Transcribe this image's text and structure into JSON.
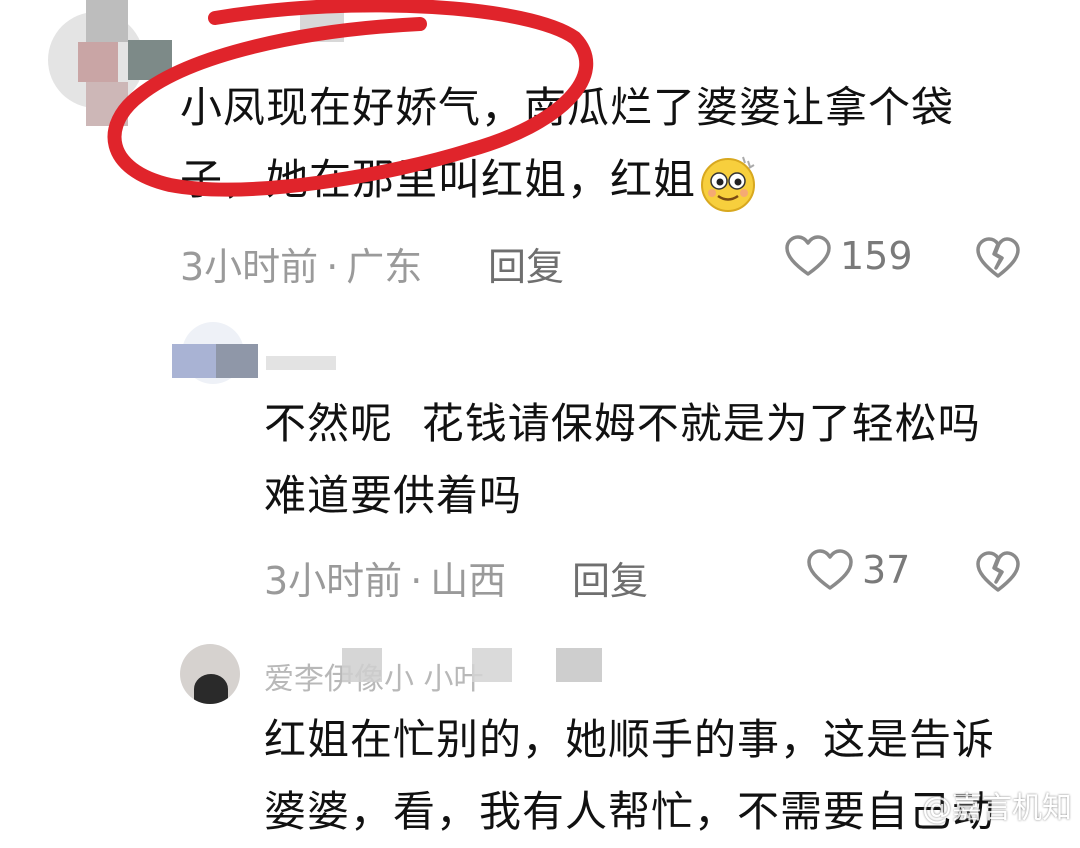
{
  "comments": [
    {
      "text_lines": [
        "小凤现在好娇气，南瓜烂了婆婆让拿个袋",
        "子，她在那里叫红姐，红姐"
      ],
      "emoji": "smile-emoji",
      "time": "3小时前",
      "region": "广东",
      "reply_label": "回复",
      "likes": "159"
    },
    {
      "text_lines": [
        "不然呢  花钱请保姆不就是为了轻松吗",
        "难道要供着吗"
      ],
      "time": "3小时前",
      "region": "山西",
      "reply_label": "回复",
      "likes": "37"
    },
    {
      "username": "爱李伊像小 小叶",
      "text_lines": [
        "红姐在忙别的，她顺手的事，这是告诉",
        "婆婆，看，我有人帮忙，不需要自己动"
      ]
    }
  ],
  "dot": "·",
  "watermark": "@嘉言机知",
  "colors": {
    "annotation_circle": "#e0242b",
    "meta_text": "#9a9a9a",
    "body_text": "#111111"
  },
  "icons": [
    "heart-outline-icon",
    "broken-heart-icon"
  ]
}
